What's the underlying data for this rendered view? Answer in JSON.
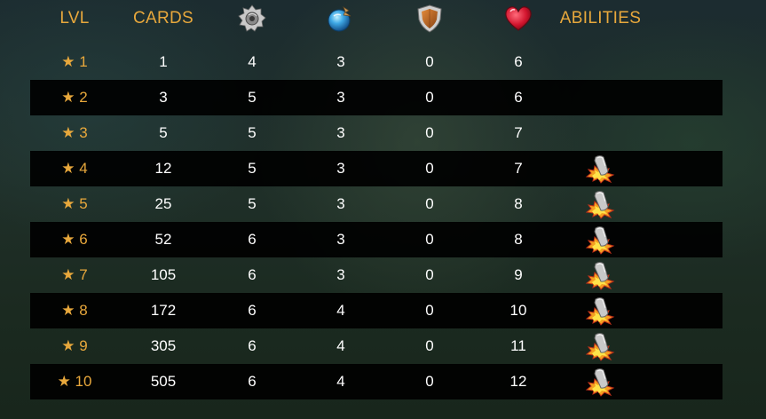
{
  "headers": {
    "level": "LVL",
    "cards": "CARDS",
    "attack_icon": "sawblade-icon",
    "speed_icon": "speed-orb-icon",
    "armor_icon": "shield-icon",
    "health_icon": "heart-icon",
    "abilities": "ABILITIES"
  },
  "colors": {
    "accent": "#e8a83c",
    "text": "#ffffff",
    "row_dark": "#000000"
  },
  "star_glyph": "★",
  "rows": [
    {
      "level": "★ 1",
      "cards": "1",
      "attack": "4",
      "speed": "3",
      "armor": "0",
      "health": "6",
      "ability": ""
    },
    {
      "level": "★ 2",
      "cards": "3",
      "attack": "5",
      "speed": "3",
      "armor": "0",
      "health": "6",
      "ability": ""
    },
    {
      "level": "★ 3",
      "cards": "5",
      "attack": "5",
      "speed": "3",
      "armor": "0",
      "health": "7",
      "ability": ""
    },
    {
      "level": "★ 4",
      "cards": "12",
      "attack": "5",
      "speed": "3",
      "armor": "0",
      "health": "7",
      "ability": "shatter-ability-icon"
    },
    {
      "level": "★ 5",
      "cards": "25",
      "attack": "5",
      "speed": "3",
      "armor": "0",
      "health": "8",
      "ability": "shatter-ability-icon"
    },
    {
      "level": "★ 6",
      "cards": "52",
      "attack": "6",
      "speed": "3",
      "armor": "0",
      "health": "8",
      "ability": "shatter-ability-icon"
    },
    {
      "level": "★ 7",
      "cards": "105",
      "attack": "6",
      "speed": "3",
      "armor": "0",
      "health": "9",
      "ability": "shatter-ability-icon"
    },
    {
      "level": "★ 8",
      "cards": "172",
      "attack": "6",
      "speed": "4",
      "armor": "0",
      "health": "10",
      "ability": "shatter-ability-icon"
    },
    {
      "level": "★ 9",
      "cards": "305",
      "attack": "6",
      "speed": "4",
      "armor": "0",
      "health": "11",
      "ability": "shatter-ability-icon"
    },
    {
      "level": "★ 10",
      "cards": "505",
      "attack": "6",
      "speed": "4",
      "armor": "0",
      "health": "12",
      "ability": "shatter-ability-icon"
    }
  ]
}
